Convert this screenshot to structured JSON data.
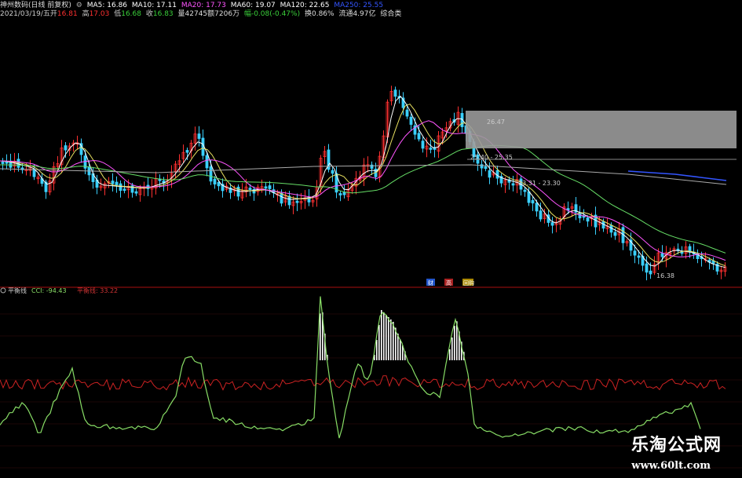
{
  "header": {
    "stock_name": "神州数码(日线 前复权)",
    "ma": [
      {
        "label": "MA5: 16.86",
        "color": "#ffffff"
      },
      {
        "label": "MA10: 17.11",
        "color": "#ffffff"
      },
      {
        "label": "MA20: 17.73",
        "color": "#ff55ff"
      },
      {
        "label": "MA60: 19.07",
        "color": "#ffffff"
      },
      {
        "label": "MA120: 22.65",
        "color": "#ffffff"
      },
      {
        "label": "MA250: 25.55",
        "color": "#3355ff"
      }
    ],
    "date": "2021/03/19/五",
    "open_label": "开",
    "open": "16.81",
    "high_label": "高",
    "high": "17.03",
    "low_label": "低",
    "low": "16.68",
    "close_label": "收",
    "close": "16.83",
    "volume": "量42745",
    "amount": "额7206万",
    "change": "幅-0.08(-0.47%)",
    "turnover": "换0.86%",
    "float_cap": "流通4.97亿",
    "info_tag": "综合类"
  },
  "price_panel": {
    "box_top_label": "26.47",
    "box_bottom_label": "25.40 - 25.35",
    "mid_label": "23.31 - 23.30",
    "low_label": "16.38",
    "event_tags": [
      "财",
      "高",
      "回购"
    ]
  },
  "indicator": {
    "name": "平衡线",
    "cci_label": "CCI: -94.43",
    "line2_label": "平衡线: 33.22"
  },
  "watermark": {
    "line1": "乐淘公式网",
    "line2": "www.60lt.com"
  },
  "colors": {
    "up": "#ff3030",
    "down": "#3ad0ff",
    "ma5": "#ffffff",
    "ma10": "#e8e060",
    "ma20": "#ff55ff",
    "ma60": "#66dd66",
    "ma120": "#aaaaaa",
    "ma250": "#3355ff",
    "cci": "#88dd66",
    "balance": "#cc2222"
  },
  "chart_data": {
    "type": "line",
    "title": "神州数码(日线 前复权)",
    "series": [
      {
        "name": "CCI",
        "values": [
          -94.43
        ]
      },
      {
        "name": "平衡线",
        "values": [
          33.22
        ]
      }
    ],
    "annotations": [
      "26.47",
      "25.40 - 25.35",
      "23.31 - 23.30",
      "16.38"
    ]
  }
}
